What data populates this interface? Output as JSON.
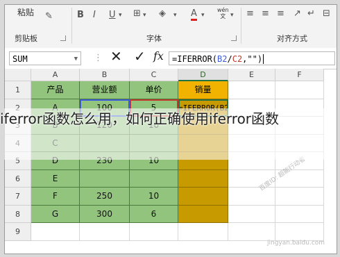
{
  "ribbon": {
    "paste_label": "粘贴",
    "clipboard_label": "剪贴板",
    "font_group_label": "字体",
    "align_group_label": "对齐方式",
    "bold": "B",
    "italic": "I",
    "underline": "U",
    "font_color": "A",
    "wen_label": "wén\n文"
  },
  "formula_bar": {
    "name_box": "SUM",
    "cancel_symbol": "✕",
    "enter_symbol": "✓",
    "fx": "fx",
    "formula_prefix": "=IFERROR(",
    "ref_b2": "B2",
    "slash": "/",
    "ref_c2": "C2",
    "formula_suffix": ",\"\")",
    "ref_b2_color": "#3b5bdb",
    "ref_c2_color": "#c0392b"
  },
  "grid": {
    "columns": [
      "A",
      "B",
      "C",
      "D",
      "E",
      "F"
    ],
    "rows": [
      "1",
      "2",
      "3",
      "4",
      "5",
      "6",
      "7",
      "8",
      "9"
    ],
    "active_column": "D",
    "cells": [
      [
        "产品",
        "营业额",
        "单价",
        "销量"
      ],
      [
        "A",
        "100",
        "5",
        "=IFERROR(B2/C2,\"\")"
      ],
      [
        "B",
        "120",
        "10",
        ""
      ],
      [
        "C",
        "",
        "",
        ""
      ],
      [
        "D",
        "230",
        "10",
        ""
      ],
      [
        "E",
        "",
        "",
        ""
      ],
      [
        "F",
        "250",
        "10",
        ""
      ],
      [
        "G",
        "300",
        "6",
        ""
      ],
      [
        "",
        "",
        "",
        ""
      ]
    ],
    "green": "#92c47d",
    "header_gold": "#f1b300",
    "dark_gold": "#c79a00"
  },
  "overlay": {
    "title": "iferror函数怎么用，如何正确使用iferror函数"
  },
  "watermark": {
    "text1": "百度ID: 超能行动者",
    "text2": "jingyan.baidu.com"
  }
}
